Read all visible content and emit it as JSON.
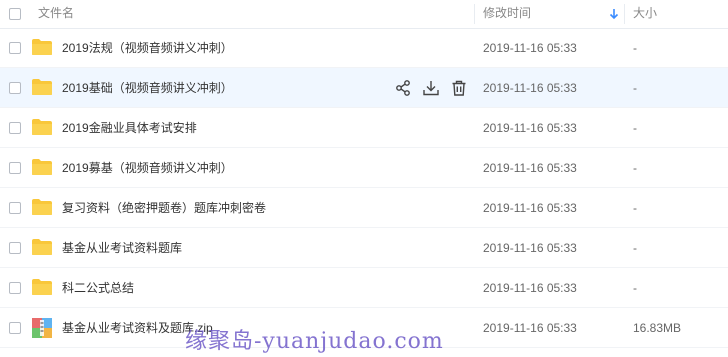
{
  "header": {
    "name_label": "文件名",
    "time_label": "修改时间",
    "size_label": "大小",
    "sort_icon": "arrow-down-icon"
  },
  "rows": [
    {
      "name": "2019法规（视频音频讲义冲刺）",
      "time": "2019-11-16 05:33",
      "size": "-",
      "icon": "folder-icon"
    },
    {
      "name": "2019基础（视频音频讲义冲刺）",
      "time": "2019-11-16 05:33",
      "size": "-",
      "icon": "folder-icon"
    },
    {
      "name": "2019金融业具体考试安排",
      "time": "2019-11-16 05:33",
      "size": "-",
      "icon": "folder-icon"
    },
    {
      "name": "2019募基（视频音频讲义冲刺）",
      "time": "2019-11-16 05:33",
      "size": "-",
      "icon": "folder-icon"
    },
    {
      "name": "复习资料（绝密押题卷）题库冲刺密卷",
      "time": "2019-11-16 05:33",
      "size": "-",
      "icon": "folder-icon"
    },
    {
      "name": "基金从业考试资料题库",
      "time": "2019-11-16 05:33",
      "size": "-",
      "icon": "folder-icon"
    },
    {
      "name": "科二公式总结",
      "time": "2019-11-16 05:33",
      "size": "-",
      "icon": "folder-icon"
    },
    {
      "name": "基金从业考试资料及题库.zip",
      "time": "2019-11-16 05:33",
      "size": "16.83MB",
      "icon": "zip-file-icon"
    }
  ],
  "hover_actions": [
    "share-icon",
    "download-icon",
    "delete-icon"
  ],
  "watermark": "缘聚岛-yuanjudao.com",
  "colors": {
    "folder": "#f9c73a",
    "hover_row": "#f0f7ff",
    "sort_arrow": "#3b8cff",
    "watermark": "#6e5ac8"
  }
}
